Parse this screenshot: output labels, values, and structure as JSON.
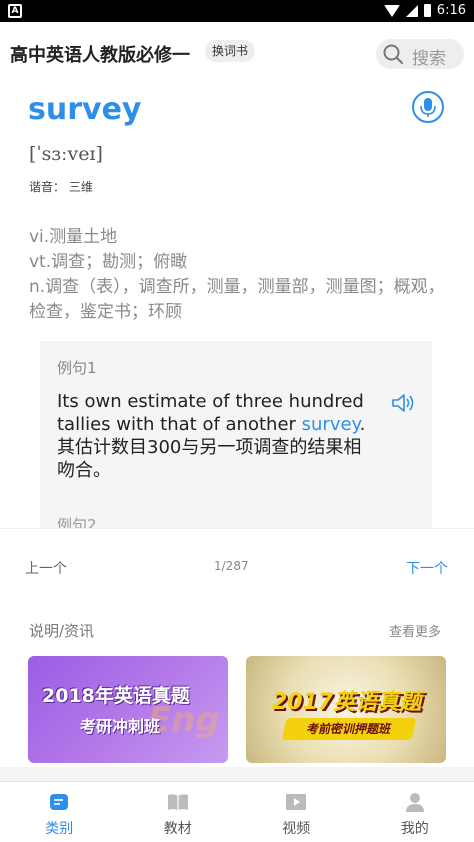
{
  "status_bar": {
    "time": "6:16",
    "app_indicator": "A"
  },
  "header": {
    "book_title": "高中英语人教版必修一",
    "change_book_label": "换词书",
    "search_placeholder": "搜索"
  },
  "word": {
    "headword": "survey",
    "phonetic": "[ˈsɜːveɪ]",
    "pronunciation": "谐音： 三维",
    "definitions": [
      "vi.测量土地",
      "vt.调查；勘测；俯瞰",
      "n.调查（表），调查所，测量，测量部，测量图；概观，检查，鉴定书；环顾"
    ]
  },
  "example": {
    "label": "例句1",
    "en_before": "Its own estimate of three hundred tallies with that of another ",
    "en_highlight": "survey",
    "en_after": ".",
    "zh": "其估计数目300与另一项调查的结果相吻合。",
    "next_label": "例句2"
  },
  "pager": {
    "prev_label": "上一个",
    "counter": "1/287",
    "next_label": "下一个"
  },
  "news": {
    "title": "说明/资讯",
    "more_label": "查看更多",
    "banners": [
      {
        "line1": "2018年英语真题",
        "line2": "考研冲刺班",
        "deco": "Eng"
      },
      {
        "line1": "2017英语真题",
        "line2": "考前密训押题班"
      }
    ]
  },
  "tabs": [
    {
      "label": "类别",
      "icon": "category-icon",
      "active": true
    },
    {
      "label": "教材",
      "icon": "book-icon",
      "active": false
    },
    {
      "label": "视频",
      "icon": "video-icon",
      "active": false
    },
    {
      "label": "我的",
      "icon": "profile-icon",
      "active": false
    }
  ],
  "colors": {
    "accent": "#2f8fe8",
    "card_bg": "#f5f5f5"
  }
}
